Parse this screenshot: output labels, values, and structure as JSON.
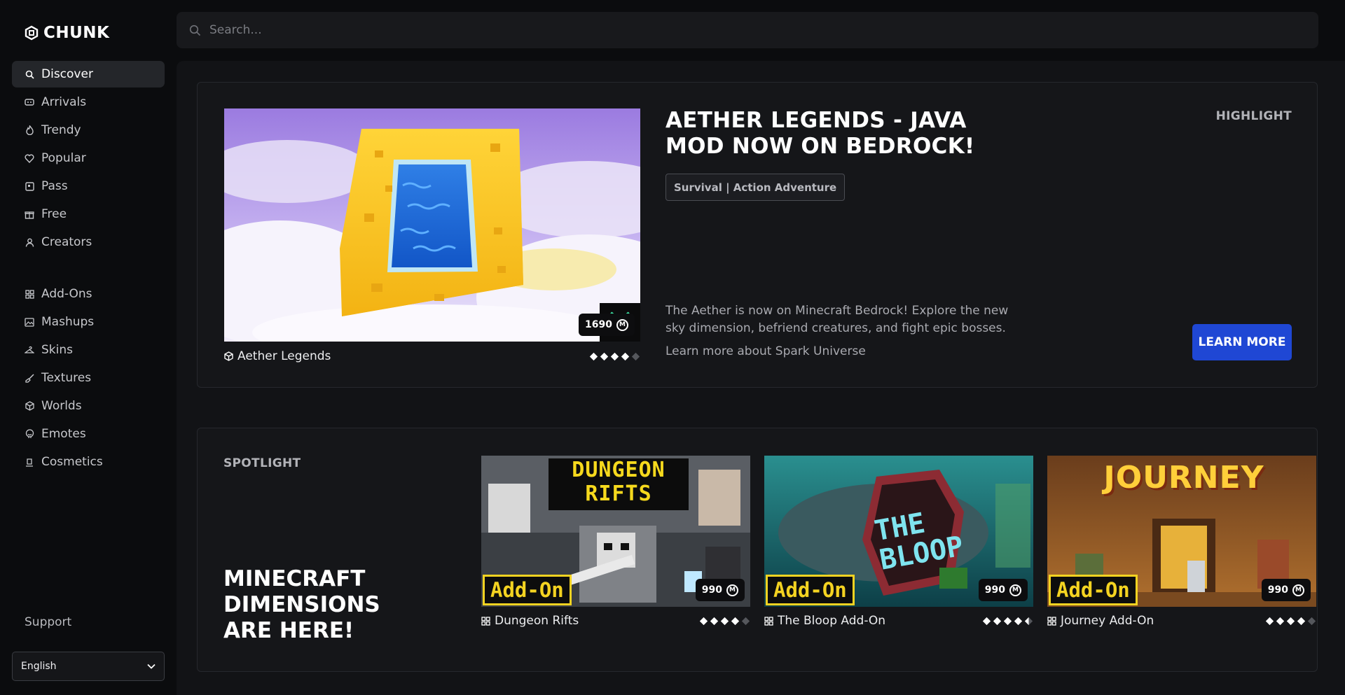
{
  "brand": {
    "name": "CHUNK"
  },
  "search": {
    "placeholder": "Search..."
  },
  "nav": {
    "primary": [
      {
        "label": "Discover",
        "icon": "search-icon"
      },
      {
        "label": "Arrivals",
        "icon": "ticket-icon"
      },
      {
        "label": "Trendy",
        "icon": "flame-icon"
      },
      {
        "label": "Popular",
        "icon": "heart-icon"
      },
      {
        "label": "Pass",
        "icon": "pass-icon"
      },
      {
        "label": "Free",
        "icon": "gift-icon"
      },
      {
        "label": "Creators",
        "icon": "user-icon"
      }
    ],
    "categories": [
      {
        "label": "Add-Ons",
        "icon": "addon-icon"
      },
      {
        "label": "Mashups",
        "icon": "image-icon"
      },
      {
        "label": "Skins",
        "icon": "hanger-icon"
      },
      {
        "label": "Textures",
        "icon": "brush-icon"
      },
      {
        "label": "Worlds",
        "icon": "cube-icon"
      },
      {
        "label": "Emotes",
        "icon": "emote-icon"
      },
      {
        "label": "Cosmetics",
        "icon": "cosmetic-icon"
      }
    ],
    "support": "Support",
    "language": "English"
  },
  "highlight": {
    "label": "HIGHLIGHT",
    "title": "AETHER LEGENDS - JAVA MOD NOW ON BEDROCK!",
    "tag": "Survival | Action Adventure",
    "description": "The Aether is now on Minecraft Bedrock! Explore the new sky dimension, befriend creatures, and fight epic bosses.",
    "link": "Learn more about Spark Universe",
    "button": "LEARN MORE",
    "product": {
      "name": "Aether Legends",
      "price": "1690",
      "rating": 4
    }
  },
  "spotlight": {
    "label": "SPOTLIGHT",
    "title": "MINECRAFT DIMENSIONS ARE HERE!",
    "items": [
      {
        "name": "Dungeon Rifts",
        "price": "990",
        "badge": "Add-On",
        "art_title": "DUNGEON RIFTS",
        "rating": 4
      },
      {
        "name": "The Bloop Add-On",
        "price": "990",
        "badge": "Add-On",
        "art_title": "THE BLOOP",
        "rating": 4.5
      },
      {
        "name": "Journey Add-On",
        "price": "990",
        "badge": "Add-On",
        "art_title": "JOURNEY",
        "rating": 4
      }
    ]
  },
  "colors": {
    "accent": "#1f47d4",
    "addon_badge": "#f4d321",
    "background": "#0b0c0e",
    "panel": "#151619"
  }
}
